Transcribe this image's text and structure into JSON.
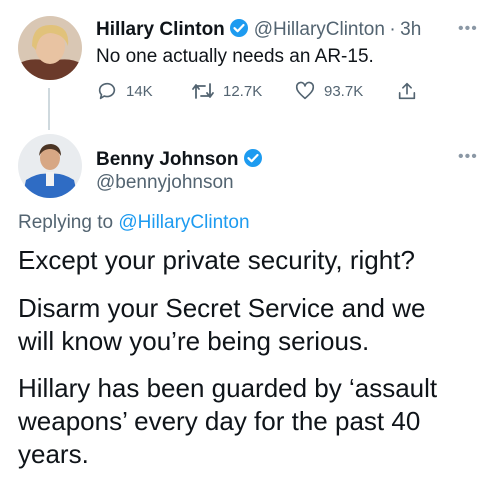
{
  "original_tweet": {
    "name": "Hillary Clinton",
    "handle": "@HillaryClinton",
    "separator": "·",
    "time": "3h",
    "text": "No one actually needs an AR-15.",
    "replies": "14K",
    "retweets": "12.7K",
    "likes": "93.7K"
  },
  "reply_tweet": {
    "name": "Benny Johnson",
    "handle": "@bennyjohnson",
    "replying_prefix": "Replying to",
    "replying_to": "@HillaryClinton",
    "paragraphs": [
      "Except your private security, right?",
      "Disarm your Secret Service and we will know you’re being serious.",
      "Hillary has been guarded by ‘assault weapons’ every day for the past 40 years."
    ]
  },
  "colors": {
    "link": "#1d9bf0",
    "muted": "#536471",
    "verified": "#1d9bf0"
  },
  "icons": [
    "verified-badge-icon",
    "reply-icon",
    "retweet-icon",
    "like-icon",
    "share-icon",
    "more-icon"
  ]
}
